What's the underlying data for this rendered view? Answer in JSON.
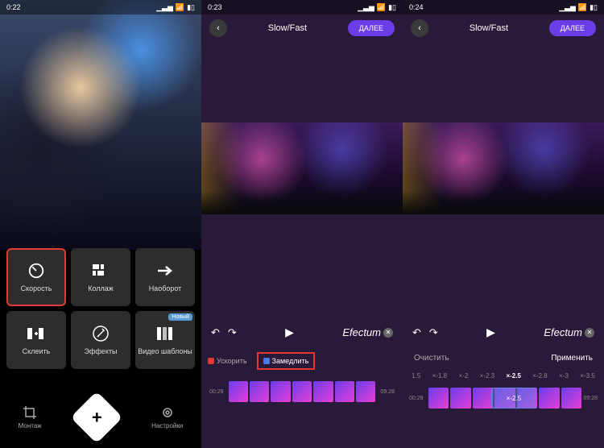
{
  "screen1": {
    "status": {
      "time": "0:22"
    },
    "tiles": [
      {
        "name": "speed",
        "label": "Скорость",
        "highlighted": true
      },
      {
        "name": "collage",
        "label": "Коллаж"
      },
      {
        "name": "reverse",
        "label": "Наоборот"
      },
      {
        "name": "merge",
        "label": "Склеить"
      },
      {
        "name": "effects",
        "label": "Эффекты"
      },
      {
        "name": "templates",
        "label": "Видео шаблоны",
        "badge": "Новый"
      }
    ],
    "nav": {
      "montage": "Монтаж",
      "settings": "Настройки"
    }
  },
  "screen2": {
    "status": {
      "time": "0:23"
    },
    "title": "Slow/Fast",
    "next": "ДАЛЕЕ",
    "brand": "Efectum",
    "accel": {
      "speedup": "Ускорить",
      "slowdown": "Замедлить"
    },
    "timeline": {
      "start": "00:28",
      "end": "09:28"
    }
  },
  "screen3": {
    "status": {
      "time": "0:24"
    },
    "title": "Slow/Fast",
    "next": "ДАЛЕЕ",
    "brand": "Efectum",
    "actions": {
      "clear": "Очистить",
      "apply": "Применить"
    },
    "scale": [
      "1.5",
      "×-1.8",
      "×-2",
      "×-2.3",
      "×-2.5",
      "×-2.8",
      "×-3",
      "×-3.5"
    ],
    "active_speed": "×-2.5",
    "overlay_speed": "×-2.5",
    "timeline": {
      "start": "00:28",
      "end": "09:28"
    }
  }
}
